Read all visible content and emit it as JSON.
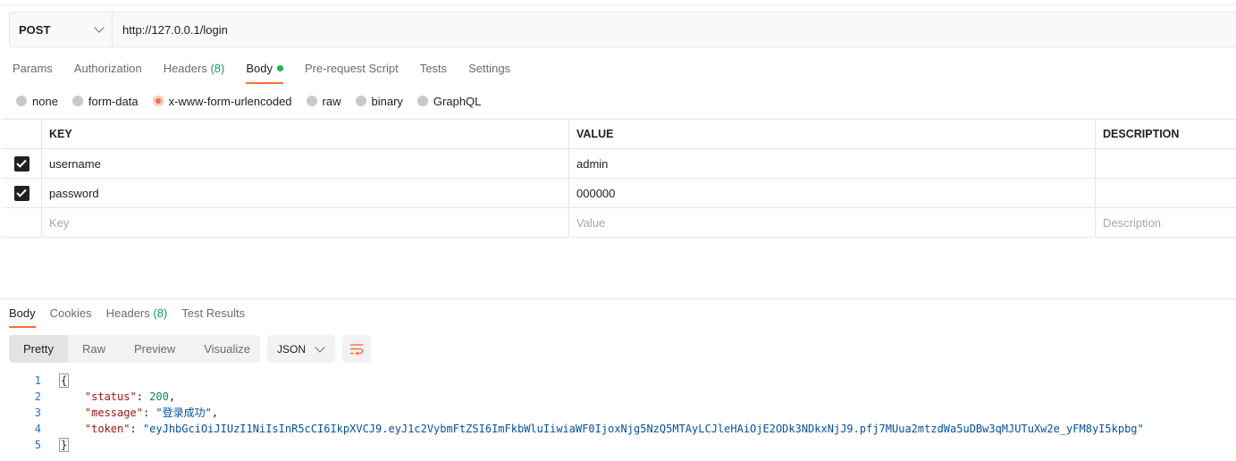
{
  "request": {
    "method": "POST",
    "url": "http://127.0.0.1/login"
  },
  "request_tabs": {
    "params": "Params",
    "authorization": "Authorization",
    "headers": "Headers",
    "headers_count": "(8)",
    "body": "Body",
    "prerequest": "Pre-request Script",
    "tests": "Tests",
    "settings": "Settings"
  },
  "body_types": {
    "none": "none",
    "form_data": "form-data",
    "urlencoded": "x-www-form-urlencoded",
    "raw": "raw",
    "binary": "binary",
    "graphql": "GraphQL",
    "selected": "x-www-form-urlencoded"
  },
  "params_table": {
    "headers": {
      "key": "KEY",
      "value": "VALUE",
      "description": "DESCRIPTION"
    },
    "rows": [
      {
        "key": "username",
        "value": "admin",
        "description": "",
        "checked": true
      },
      {
        "key": "password",
        "value": "000000",
        "description": "",
        "checked": true
      }
    ],
    "placeholders": {
      "key": "Key",
      "value": "Value",
      "description": "Description"
    }
  },
  "response_tabs": {
    "body": "Body",
    "cookies": "Cookies",
    "headers": "Headers",
    "headers_count": "(8)",
    "test_results": "Test Results"
  },
  "view_modes": {
    "pretty": "Pretty",
    "raw": "Raw",
    "preview": "Preview",
    "visualize": "Visualize",
    "format": "JSON"
  },
  "response_body": {
    "line_numbers": [
      "1",
      "2",
      "3",
      "4",
      "5"
    ],
    "open_brace": "{",
    "close_brace": "}",
    "status_key": "\"status\"",
    "status_value": "200",
    "message_key": "\"message\"",
    "message_value": "\"登录成功\"",
    "token_key": "\"token\"",
    "token_value": "\"eyJhbGciOiJIUzI1NiIsInR5cCI6IkpXVCJ9.eyJ1c2VybmFtZSI6ImFkbWluIiwiaWF0IjoxNjg5NzQ5MTAyLCJleHAiOjE2ODk3NDkxNjJ9.pfj7MUua2mtzdWa5uDBw3qMJUTuXw2e_yFM8yI5kpbg\""
  },
  "colors": {
    "accent": "#ff6c37",
    "success": "#0cbb52"
  }
}
